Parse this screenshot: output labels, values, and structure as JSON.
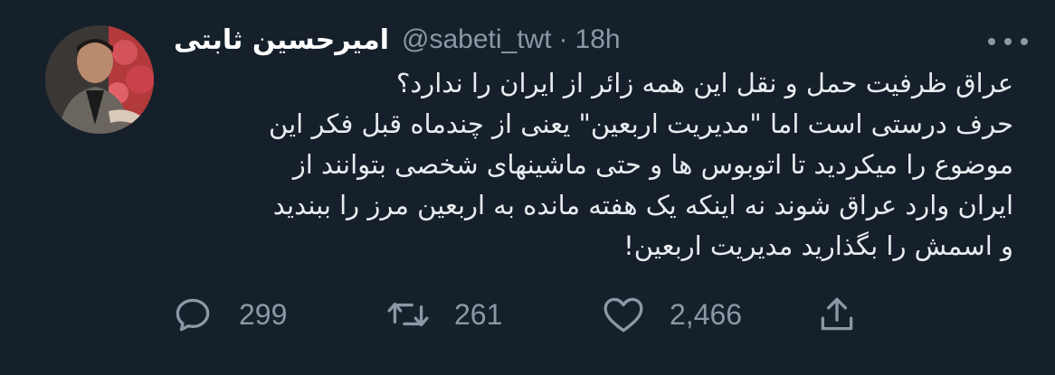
{
  "tweet": {
    "display_name": "امیرحسین ثابتی",
    "handle": "@sabeti_twt",
    "separator": "·",
    "time": "18h",
    "lines": [
      "عراق ظرفیت حمل و نقل این همه زائر از ایران را ندارد؟",
      "حرف درستی است اما \"مدیریت اربعین\" یعنی از چندماه قبل فکر این",
      "موضوع را میکردید تا اتوبوس ها و حتی ماشینهای شخصی بتوانند از",
      "ایران وارد عراق شوند نه اینکه یک هفته مانده به اربعین مرز را ببندید",
      "و اسمش را بگذارید مدیریت اربعین!"
    ]
  },
  "actions": {
    "reply": {
      "icon": "reply-icon",
      "count": "299"
    },
    "retweet": {
      "icon": "retweet-icon",
      "count": "261"
    },
    "like": {
      "icon": "heart-icon",
      "count": "2,466"
    },
    "share": {
      "icon": "share-icon"
    }
  },
  "more_icon": "more-horizontal-icon",
  "colors": {
    "background": "#15202b",
    "text": "#e8ecef",
    "secondary": "#8b98a5"
  }
}
